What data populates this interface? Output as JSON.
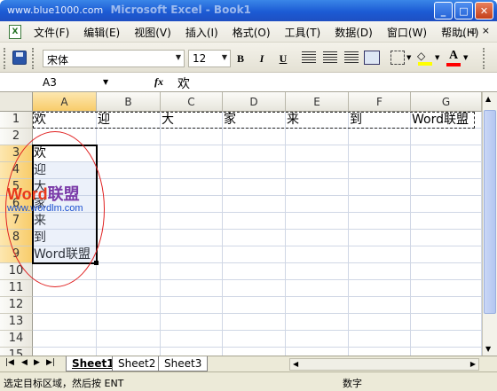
{
  "window": {
    "watermark_url": "www.blue1000.com",
    "title": "Microsoft Excel - Book1",
    "controls": [
      "minimize",
      "maximize",
      "close"
    ]
  },
  "menu": {
    "items": [
      "文件(F)",
      "编辑(E)",
      "视图(V)",
      "插入(I)",
      "格式(O)",
      "工具(T)",
      "数据(D)",
      "窗口(W)",
      "帮助(H)"
    ],
    "right_controls": [
      "_",
      "▫",
      "×"
    ]
  },
  "toolbar": {
    "font_name": "宋体",
    "font_size": "12",
    "bold": "B",
    "italic": "I",
    "underline": "U",
    "font_color_label": "A",
    "fill_color": "#ffff00",
    "font_color": "#ff0000"
  },
  "formula_bar": {
    "name_box": "A3",
    "fx_label": "fx",
    "content": "欢"
  },
  "grid": {
    "columns": [
      "A",
      "B",
      "C",
      "D",
      "E",
      "F",
      "G"
    ],
    "rows": [
      "1",
      "2",
      "3",
      "4",
      "5",
      "6",
      "7",
      "8",
      "9",
      "10",
      "11",
      "12",
      "13",
      "14",
      "15"
    ],
    "row1": [
      "欢",
      "迎",
      "大",
      "家",
      "来",
      "到",
      "Word联盟"
    ],
    "colA": [
      "欢",
      "迎",
      "大",
      "家",
      "来",
      "到",
      "Word联盟"
    ],
    "active_cell": "A3",
    "selected_range": "A3:A9",
    "copy_range": "A1:G1"
  },
  "watermark": {
    "logo_word": "Word",
    "logo_cn": "联盟",
    "url": "www.wordlm.com"
  },
  "sheets": {
    "tabs": [
      "Sheet1",
      "Sheet2",
      "Sheet3"
    ],
    "active": "Sheet1"
  },
  "status": {
    "message": "选定目标区域，然后按 ENT",
    "mode": "数字"
  }
}
